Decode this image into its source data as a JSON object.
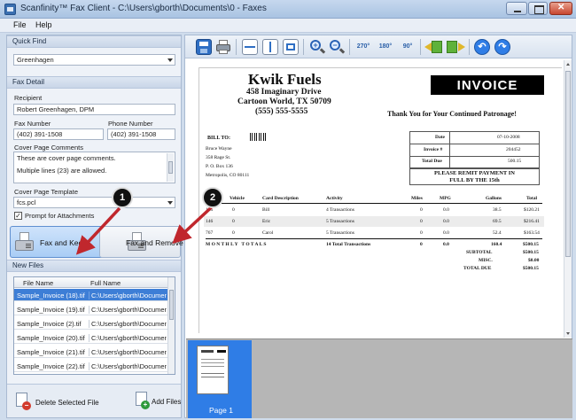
{
  "window": {
    "title": "Scanfinity™ Fax Client - C:\\Users\\gborth\\Documents\\0 - Faxes"
  },
  "menu": [
    "File",
    "Help"
  ],
  "quick_find": {
    "header": "Quick Find",
    "value": "Greenhagen"
  },
  "fax_detail": {
    "header": "Fax Detail",
    "recipient_label": "Recipient",
    "recipient_value": "Robert Greenhagen, DPM",
    "fax_number_label": "Fax Number",
    "fax_number_value": "(402) 391-1508",
    "phone_number_label": "Phone Number",
    "phone_number_value": "(402) 391-1508",
    "comments_label": "Cover Page Comments",
    "comments_line1": "These are cover page comments.",
    "comments_line2": "Multiple lines (23) are allowed.",
    "template_label": "Cover Page Template",
    "template_value": "fcs.pcl",
    "prompt_label": "Prompt for Attachments",
    "prompt_checked": true
  },
  "actions": {
    "fax_and_keep": "Fax and Keep",
    "fax_and_remove": "Fax and Remove"
  },
  "new_files": {
    "header": "New Files",
    "columns": [
      "File Name",
      "Full Name"
    ],
    "rows": [
      {
        "file": "Sample_Invoice (18).tif",
        "full": "C:\\Users\\gborth\\Documen",
        "selected": true
      },
      {
        "file": "Sample_Invoice (19).tif",
        "full": "C:\\Users\\gborth\\Documen",
        "selected": false
      },
      {
        "file": "Sample_Invoice (2).tif",
        "full": "C:\\Users\\gborth\\Documen",
        "selected": false
      },
      {
        "file": "Sample_Invoice (20).tif",
        "full": "C:\\Users\\gborth\\Documen",
        "selected": false
      },
      {
        "file": "Sample_Invoice (21).tif",
        "full": "C:\\Users\\gborth\\Documen",
        "selected": false
      },
      {
        "file": "Sample_Invoice (22).tif",
        "full": "C:\\Users\\gborth\\Documen",
        "selected": false
      }
    ]
  },
  "bottom": {
    "delete_label": "Delete Selected File",
    "add_label": "Add Files"
  },
  "toolbar_icons": [
    "save-icon",
    "print-icon",
    "fit-width-icon",
    "fit-page-icon",
    "fit-height-icon",
    "zoom-in-icon",
    "zoom-out-icon",
    "rotate-270-icon",
    "rotate-180-icon",
    "rotate-90-icon",
    "previous-page-icon",
    "next-page-icon",
    "undo-icon",
    "redo-icon"
  ],
  "toolbar_rot": [
    "270°",
    "180°",
    "90°"
  ],
  "invoice": {
    "company": "Kwik Fuels",
    "address1": "458 Imaginary Drive",
    "address2": "Cartoon World, TX 50709",
    "phone": "(555) 555-5555",
    "banner": "INVOICE",
    "thanks": "Thank You for Your Continued Patronage!",
    "bill_to": "BILL TO:",
    "bill_lines": [
      "Bruce Wayne",
      "358 Rage St.",
      "P. O. Box 136",
      "Metropolis, CO 80111"
    ],
    "meta": [
      {
        "k": "Date",
        "v": "07-10-2008"
      },
      {
        "k": "Invoice #",
        "v": "204452"
      },
      {
        "k": "Total Due",
        "v": "500.15"
      }
    ],
    "remit": [
      "PLEASE REMIT PAYMENT IN",
      "FULL BY THE 15th"
    ],
    "headers": [
      "Vehicle",
      "Card Description",
      "Activity",
      "Miles",
      "MPG",
      "Gallons",
      "Total"
    ],
    "rows": [
      {
        "id": "145",
        "veh": "0",
        "card": "Bill",
        "act": "4 Transactions",
        "miles": "0",
        "mpg": "0.0",
        "gal": "38.5",
        "tot": "$120.21"
      },
      {
        "id": "146",
        "veh": "0",
        "card": "Eric",
        "act": "5 Transactions",
        "miles": "0",
        "mpg": "0.0",
        "gal": "69.5",
        "tot": "$216.41"
      },
      {
        "id": "767",
        "veh": "0",
        "card": "Carol",
        "act": "5 Transactions",
        "miles": "0",
        "mpg": "0.0",
        "gal": "52.4",
        "tot": "$163.54"
      }
    ],
    "monthly": {
      "label": "M O N T H L Y   T O T A L S",
      "act": "14 Total Transactions",
      "miles": "0",
      "mpg": "0.0",
      "gal": "160.4",
      "tot": "$500.15"
    },
    "summary": [
      {
        "k": "SUBTOTAL",
        "v": "$500.15"
      },
      {
        "k": "MISC.",
        "v": "$0.00"
      },
      {
        "k": "TOTAL DUE",
        "v": "$500.15"
      }
    ]
  },
  "thumbnail": {
    "label": "Page 1"
  },
  "callouts": [
    "1",
    "2"
  ],
  "colors": {
    "accent": "#3d7ed6",
    "arrow": "#c0272d"
  }
}
